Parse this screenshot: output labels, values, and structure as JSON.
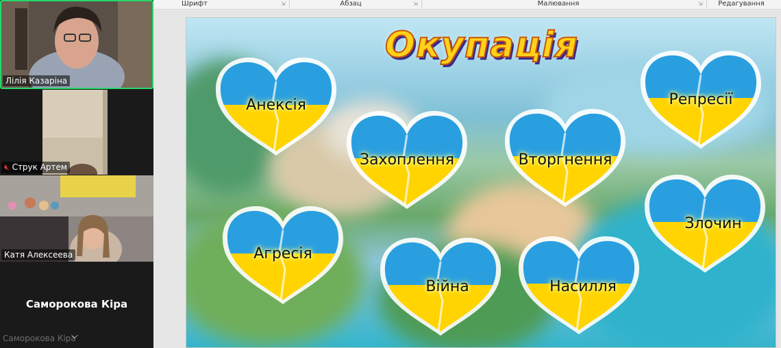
{
  "participants": [
    {
      "name": "Лілія Казаріна",
      "active_speaker": true
    },
    {
      "name": "Струк Артем",
      "muted": true
    },
    {
      "name": "Катя Алексеева"
    },
    {
      "name": "Саморокова Кіра",
      "caption_name": "Саморокова Кіра",
      "video_off": true
    }
  ],
  "ribbon": {
    "groups": [
      "Шрифт",
      "Абзац",
      "Малювання",
      "Редагування"
    ]
  },
  "slide": {
    "title": "Окупація",
    "hearts": [
      "Анексія",
      "Захоплення",
      "Вторгнення",
      "Репресії",
      "Злочин",
      "Агресія",
      "Війна",
      "Насилля"
    ]
  },
  "colors": {
    "heart_blue": "#2a9fe0",
    "heart_yellow": "#ffd400",
    "title_fill": "#ffd21a",
    "active_border": "#24d86a"
  },
  "icons": [
    "mic-muted-icon",
    "chevron-down-icon",
    "dialog-launcher-icon"
  ]
}
